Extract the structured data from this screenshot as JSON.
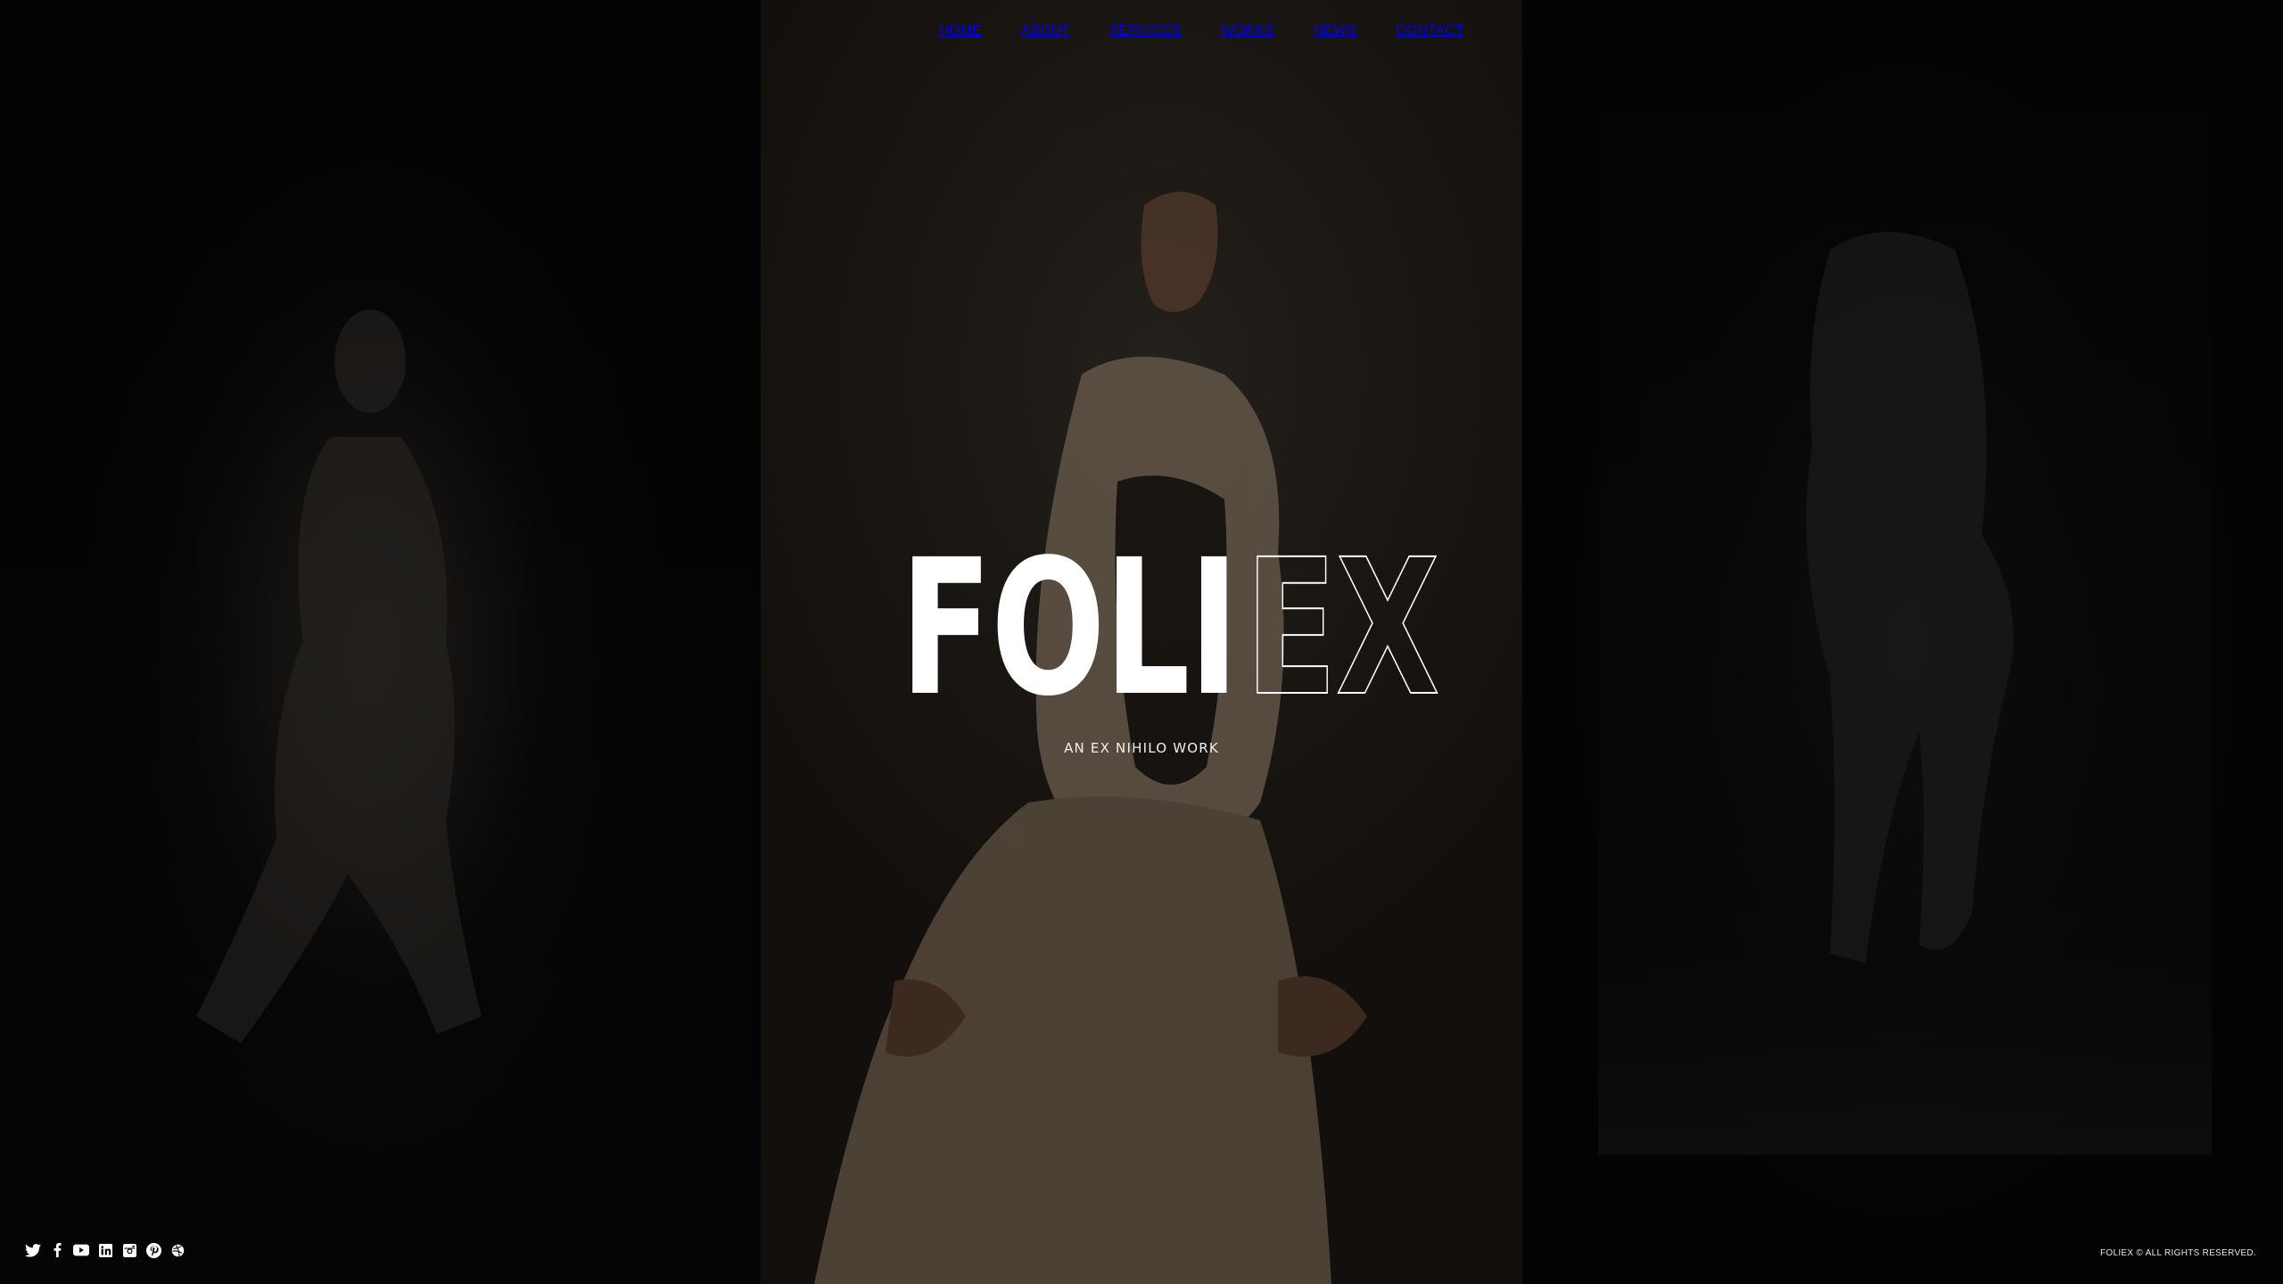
{
  "nav": {
    "items": [
      {
        "label": "HOME"
      },
      {
        "label": "ABOUT"
      },
      {
        "label": "SERVICES"
      },
      {
        "label": "WORKS"
      },
      {
        "label": "NEWS"
      },
      {
        "label": "CONTACT"
      }
    ]
  },
  "hero": {
    "title_solid": "FOLI",
    "title_outline": "EX",
    "tagline": "AN EX NIHILO WORK"
  },
  "social": {
    "icons": [
      "twitter-icon",
      "facebook-icon",
      "youtube-icon",
      "linkedin-icon",
      "instagram-icon",
      "pinterest-icon",
      "dribbble-icon"
    ]
  },
  "footer": {
    "copyright": "FOLIEX © ALL RIGHTS RESERVED."
  },
  "colors": {
    "background": "#000000",
    "center_panel": "#201c18",
    "text": "#ffffff"
  }
}
